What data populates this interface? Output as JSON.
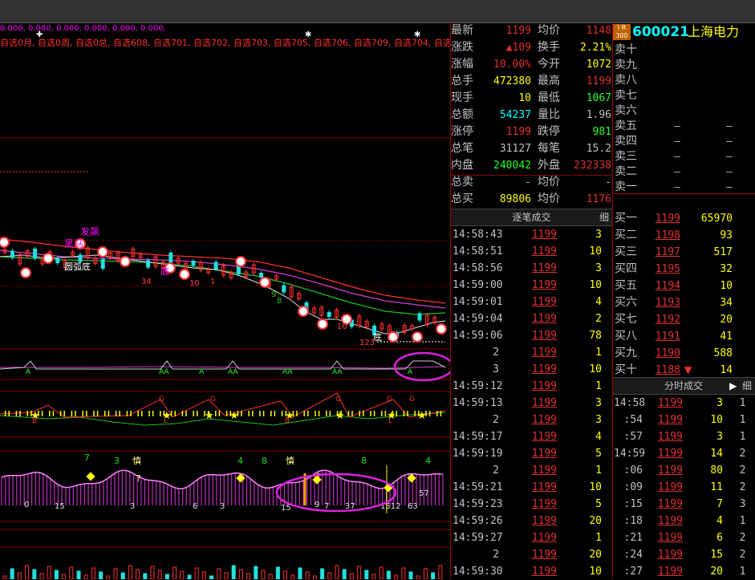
{
  "top_values": "0.000, 0.000, 0.000, 0.000, 0.000, 0.000,",
  "watchlists": "自选0月, 自选0周, 自选0总, 自选608, 自选701, 自选702, 自选703, 自选705, 自选706, 自选709, 自选704, 自选",
  "chart_labels": {
    "faqiang": "发飙",
    "heima": "黑马",
    "yuanhudi": "圆弧底",
    "di": "底",
    "shen": "慎",
    "q": "?",
    "aa": "AA",
    "a": "A",
    "g": "G",
    "l": "L",
    "b": "B",
    "n34": "34",
    "n10a": "10",
    "n10b": "10",
    "n1a": "1",
    "n8": "8",
    "n9": "9",
    "n5": "5",
    "n12": "12",
    "n123": "123",
    "n7": "7",
    "n3": "3",
    "n4": "4",
    "n8b": "8",
    "n4b": "4",
    "b0a": "0",
    "b15": "15",
    "b3": "3",
    "b6": "6",
    "b3b": "3",
    "b15b": "15",
    "b9": "9",
    "b7": "7",
    "b37": "37",
    "b1512": "1512",
    "b63": "63",
    "b57": "57"
  },
  "quote": {
    "rows": [
      {
        "l1": "最新",
        "v1": "1199",
        "l2": "均价",
        "v2": "1148"
      },
      {
        "l1": "涨跌",
        "v1": "▲109",
        "l2": "换手",
        "v2": "2.21%"
      },
      {
        "l1": "涨幅",
        "v1": "10.00%",
        "l2": "今开",
        "v2": "1072"
      },
      {
        "l1": "总手",
        "v1": "472380",
        "l2": "最高",
        "v2": "1199"
      },
      {
        "l1": "现手",
        "v1": "10",
        "l2": "最低",
        "v2": "1067"
      },
      {
        "l1": "总额",
        "v1": "54237",
        "l2": "量比",
        "v2": "1.96"
      },
      {
        "l1": "涨停",
        "v1": "1199",
        "l2": "跌停",
        "v2": "981"
      },
      {
        "l1": "总笔",
        "v1": "31127",
        "l2": "每笔",
        "v2": "15.2"
      },
      {
        "l1": "内盘",
        "v1": "240042",
        "l2": "外盘",
        "v2": "232338"
      },
      {
        "l1": "总卖",
        "v1": "-",
        "l2": "均价",
        "v2": "-"
      },
      {
        "l1": "总买",
        "v1": "89806",
        "l2": "均价",
        "v2": "1176"
      }
    ]
  },
  "stock": {
    "badge": "I R 300",
    "code": "600021",
    "name": "上海电力"
  },
  "sell": [
    {
      "l": "卖十",
      "p": "",
      "v": "",
      "d": ""
    },
    {
      "l": "卖九",
      "p": "",
      "v": "",
      "d": ""
    },
    {
      "l": "卖八",
      "p": "",
      "v": "",
      "d": ""
    },
    {
      "l": "卖七",
      "p": "",
      "v": "",
      "d": ""
    },
    {
      "l": "卖六",
      "p": "",
      "v": "",
      "d": ""
    },
    {
      "l": "卖五",
      "p": "–",
      "v": "–",
      "d": ""
    },
    {
      "l": "卖四",
      "p": "–",
      "v": "–",
      "d": ""
    },
    {
      "l": "卖三",
      "p": "–",
      "v": "–",
      "d": ""
    },
    {
      "l": "卖二",
      "p": "–",
      "v": "–",
      "d": ""
    },
    {
      "l": "卖一",
      "p": "–",
      "v": "–",
      "d": ""
    }
  ],
  "buy": [
    {
      "l": "买一",
      "p": "1199",
      "v": "65970",
      "d": ""
    },
    {
      "l": "买二",
      "p": "1198",
      "v": "93",
      "d": ""
    },
    {
      "l": "买三",
      "p": "1197",
      "v": "517",
      "d": ""
    },
    {
      "l": "买四",
      "p": "1195",
      "v": "32",
      "d": ""
    },
    {
      "l": "买五",
      "p": "1194",
      "v": "10",
      "d": ""
    },
    {
      "l": "买六",
      "p": "1193",
      "v": "34",
      "d": ""
    },
    {
      "l": "买七",
      "p": "1192",
      "v": "20",
      "d": ""
    },
    {
      "l": "买八",
      "p": "1191",
      "v": "41",
      "d": ""
    },
    {
      "l": "买九",
      "p": "1190",
      "v": "588",
      "d": ""
    },
    {
      "l": "买十",
      "p": "1188",
      "v": "14",
      "d": "▼"
    }
  ],
  "ticks_header": {
    "title": "逐笔成交",
    "detail": "细"
  },
  "ticks": [
    {
      "t": "14:58:43",
      "p": "1199",
      "v": "3"
    },
    {
      "t": "14:58:51",
      "p": "1199",
      "v": "10"
    },
    {
      "t": "14:58:56",
      "p": "1199",
      "v": "3"
    },
    {
      "t": "14:59:00",
      "p": "1199",
      "v": "10"
    },
    {
      "t": "14:59:01",
      "p": "1199",
      "v": "4"
    },
    {
      "t": "14:59:04",
      "p": "1199",
      "v": "2"
    },
    {
      "t": "14:59:06",
      "p": "1199",
      "v": "78"
    },
    {
      "t": "2",
      "p": "1199",
      "v": "1"
    },
    {
      "t": "3",
      "p": "1199",
      "v": "10"
    },
    {
      "t": "14:59:12",
      "p": "1199",
      "v": "1"
    },
    {
      "t": "14:59:13",
      "p": "1199",
      "v": "3"
    },
    {
      "t": "2",
      "p": "1199",
      "v": "3"
    },
    {
      "t": "14:59:17",
      "p": "1199",
      "v": "4"
    },
    {
      "t": "14:59:19",
      "p": "1199",
      "v": "5"
    },
    {
      "t": "2",
      "p": "1199",
      "v": "1"
    },
    {
      "t": "14:59:21",
      "p": "1199",
      "v": "10"
    },
    {
      "t": "14:59:23",
      "p": "1199",
      "v": "5"
    },
    {
      "t": "14:59:26",
      "p": "1199",
      "v": "20"
    },
    {
      "t": "14:59:27",
      "p": "1199",
      "v": "1"
    },
    {
      "t": "2",
      "p": "1199",
      "v": "20"
    },
    {
      "t": "14:59:30",
      "p": "1199",
      "v": "10"
    }
  ],
  "minute_header": {
    "title": "分时成交",
    "arrow": "▶",
    "detail": "细"
  },
  "minute": [
    {
      "t": "14:58",
      "p": "1199",
      "v": "3",
      "n": "1"
    },
    {
      "t": ":54",
      "p": "1199",
      "v": "10",
      "n": "1"
    },
    {
      "t": ":57",
      "p": "1199",
      "v": "3",
      "n": "1"
    },
    {
      "t": "14:59",
      "p": "1199",
      "v": "14",
      "n": "2"
    },
    {
      "t": ":06",
      "p": "1199",
      "v": "80",
      "n": "2"
    },
    {
      "t": ":09",
      "p": "1199",
      "v": "11",
      "n": "2"
    },
    {
      "t": ":15",
      "p": "1199",
      "v": "7",
      "n": "3"
    },
    {
      "t": ":18",
      "p": "1199",
      "v": "4",
      "n": "1"
    },
    {
      "t": ":21",
      "p": "1199",
      "v": "6",
      "n": "2"
    },
    {
      "t": ":24",
      "p": "1199",
      "v": "15",
      "n": "2"
    },
    {
      "t": ":27",
      "p": "1199",
      "v": "20",
      "n": "1"
    }
  ]
}
